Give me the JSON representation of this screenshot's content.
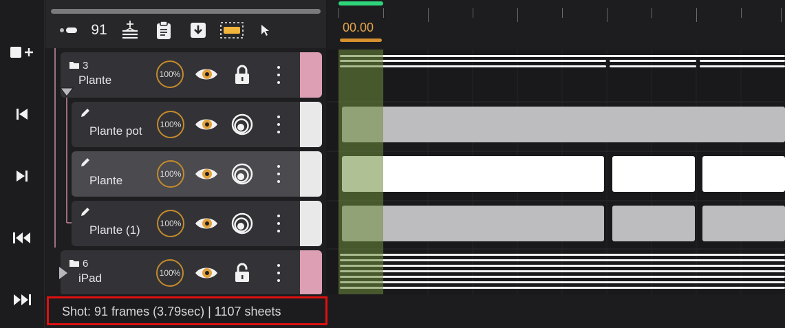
{
  "toolbar": {
    "frame_count": "91",
    "icons": [
      "onion-dots-icon",
      "add-layer-stack-icon",
      "paste-icon",
      "import-icon",
      "selection-rect-icon",
      "pointer-icon"
    ]
  },
  "nav": {
    "icons": [
      "add-frame-icon",
      "step-back-icon",
      "step-forward-icon",
      "rewind-icon",
      "fast-forward-icon"
    ]
  },
  "timeline": {
    "current_time": "00.00"
  },
  "layers": [
    {
      "number": "3",
      "name": "Plante",
      "opacity": "100%",
      "type": "folder",
      "lock": "locked",
      "swatch": "#dc9fb4"
    },
    {
      "name": "Plante pot",
      "opacity": "100%",
      "type": "drawing",
      "swatch": "#e9e9ea"
    },
    {
      "name": "Plante",
      "opacity": "100%",
      "type": "drawing",
      "selected": true,
      "swatch": "#e9e9ea"
    },
    {
      "name": "Plante (1)",
      "opacity": "100%",
      "type": "drawing",
      "swatch": "#e9e9ea"
    },
    {
      "number": "6",
      "name": "iPad",
      "opacity": "100%",
      "type": "folder",
      "lock": "unlocked",
      "swatch": "#dc9fb4"
    }
  ],
  "status": {
    "text": "Shot: 91 frames (3.79sec) | 1107 sheets"
  },
  "colors": {
    "accent_orange": "#d6902e",
    "playhead_green": "#2ed57a",
    "folder_swatch": "#dc9fb4",
    "highlight_red": "#e01010"
  }
}
